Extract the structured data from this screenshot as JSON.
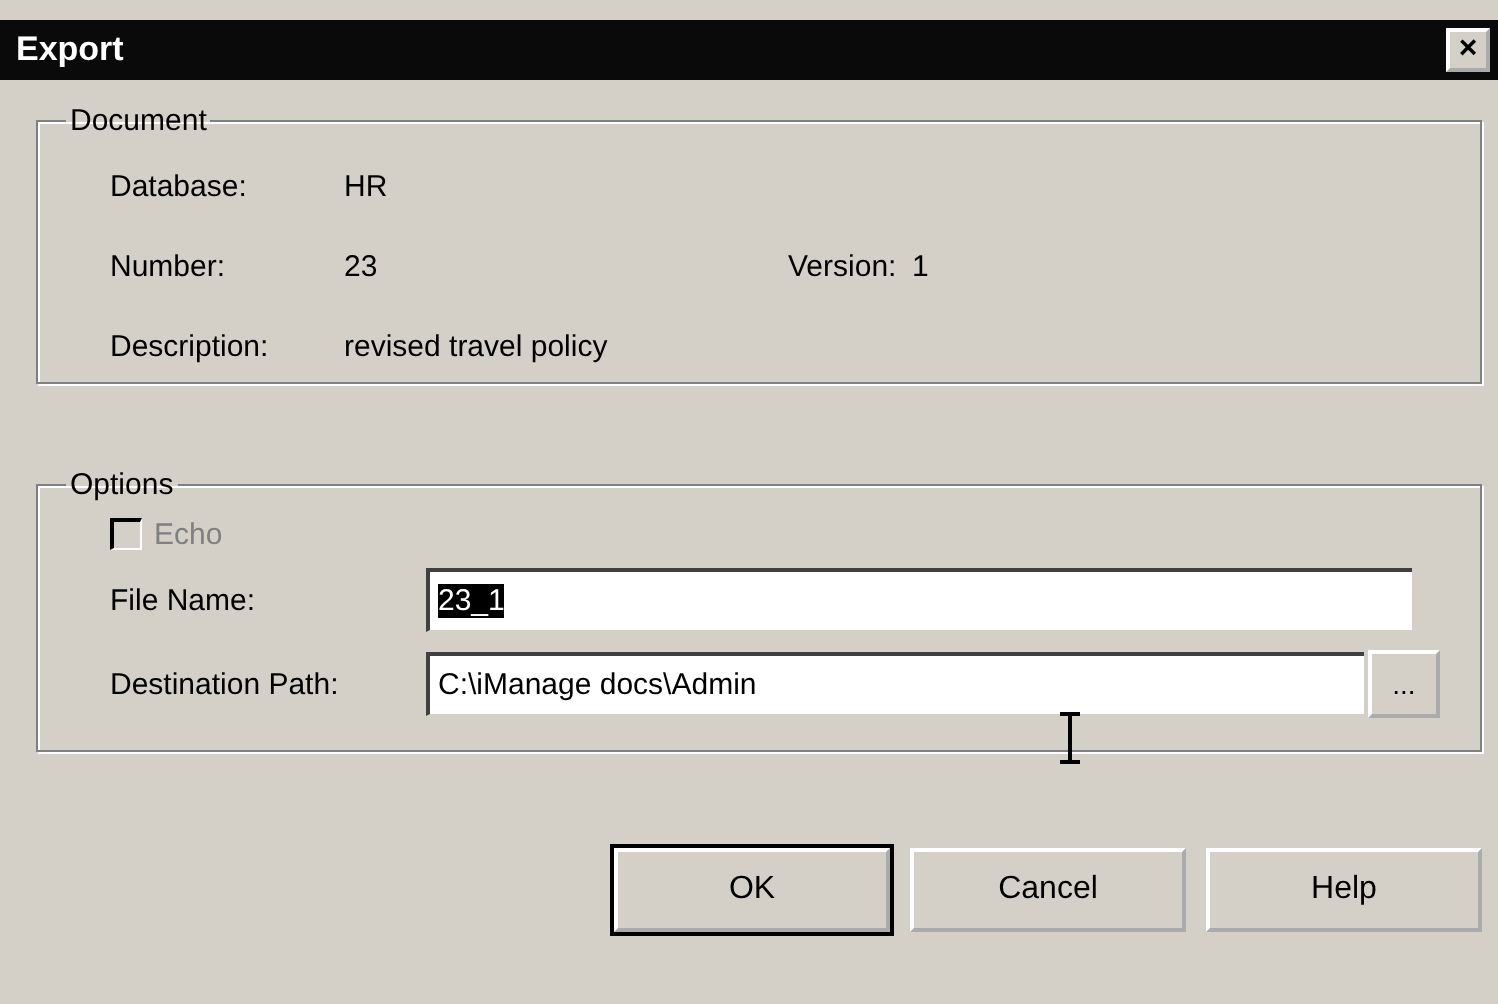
{
  "window": {
    "title": "Export",
    "close": "×"
  },
  "document": {
    "legend": "Document",
    "fields": [
      {
        "label": "Database:",
        "value": "HR"
      },
      {
        "label": "Number:",
        "value": "23",
        "extra_label": "Version:",
        "extra_value": "1"
      },
      {
        "label": "Description:",
        "value": "revised travel policy"
      }
    ]
  },
  "options": {
    "legend": "Options",
    "echo": {
      "label": "Echo",
      "checked": false,
      "disabled": true
    },
    "file_name": {
      "label": "File Name:",
      "value": "23_1",
      "selected": true
    },
    "destination": {
      "label": "Destination Path:",
      "value": "C:\\iManage docs\\Admin",
      "browse": "..."
    }
  },
  "buttons": [
    {
      "label": "OK",
      "default": true
    },
    {
      "label": "Cancel",
      "default": false
    },
    {
      "label": "Help",
      "default": false
    }
  ]
}
